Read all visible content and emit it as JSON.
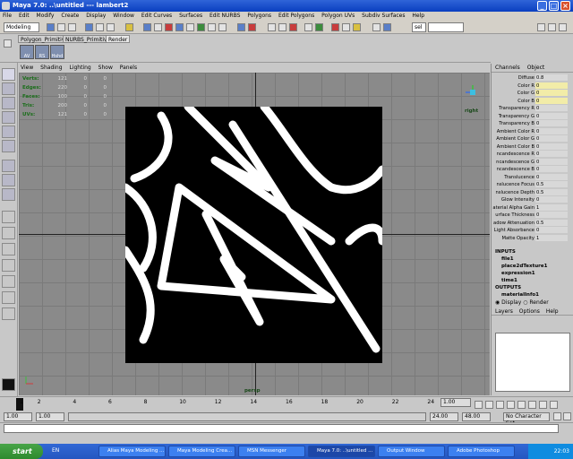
{
  "title": "Maya 7.0: ..\\untitled   ---   lambert2",
  "menus": [
    "File",
    "Edit",
    "Modify",
    "Create",
    "Display",
    "Window",
    "Edit Curves",
    "Surfaces",
    "Edit NURBS",
    "Polygons",
    "Edit Polygons",
    "Polygon UVs",
    "Subdiv Surfaces",
    "Help"
  ],
  "status": {
    "mode": "Modeling",
    "selection_field": "sel"
  },
  "shelf": {
    "tabs": [
      "Polygon_Primitives",
      "NURBS_Primitives",
      "Render"
    ],
    "buttons": [
      "AV",
      "RS",
      "Hshd"
    ]
  },
  "panel_menu": [
    "View",
    "Shading",
    "Lighting",
    "Show",
    "Panels"
  ],
  "hud": [
    {
      "label": "Verts:",
      "a": "121",
      "b": "0",
      "c": "0"
    },
    {
      "label": "Edges:",
      "a": "220",
      "b": "0",
      "c": "0"
    },
    {
      "label": "Faces:",
      "a": "100",
      "b": "0",
      "c": "0"
    },
    {
      "label": "Tris:",
      "a": "200",
      "b": "0",
      "c": "0"
    },
    {
      "label": "UVs:",
      "a": "121",
      "b": "0",
      "c": "0"
    }
  ],
  "camera_label": "persp",
  "compass": {
    "label": "right",
    "y": "y",
    "z": "z"
  },
  "channels": {
    "menu": [
      "Channels",
      "Object"
    ],
    "attrs": [
      {
        "name": "Diffuse",
        "value": "0.8",
        "highlight": false
      },
      {
        "name": "Color R",
        "value": "0",
        "highlight": true
      },
      {
        "name": "Color G",
        "value": "0",
        "highlight": true
      },
      {
        "name": "Color B",
        "value": "0",
        "highlight": true
      },
      {
        "name": "Transparency R",
        "value": "0",
        "highlight": false
      },
      {
        "name": "Transparency G",
        "value": "0",
        "highlight": false
      },
      {
        "name": "Transparency B",
        "value": "0",
        "highlight": false
      },
      {
        "name": "Ambient Color R",
        "value": "0",
        "highlight": false
      },
      {
        "name": "Ambient Color G",
        "value": "0",
        "highlight": false
      },
      {
        "name": "Ambient Color B",
        "value": "0",
        "highlight": false
      },
      {
        "name": "ncandescence R",
        "value": "0",
        "highlight": false
      },
      {
        "name": "ncandescence G",
        "value": "0",
        "highlight": false
      },
      {
        "name": "ncandescence B",
        "value": "0",
        "highlight": false
      },
      {
        "name": "Translucence",
        "value": "0",
        "highlight": false
      },
      {
        "name": "nslucence Focus",
        "value": "0.5",
        "highlight": false
      },
      {
        "name": "nslucence Depth",
        "value": "0.5",
        "highlight": false
      },
      {
        "name": "Glow Intensity",
        "value": "0",
        "highlight": false
      },
      {
        "name": "aterial Alpha Gain",
        "value": "1",
        "highlight": false
      },
      {
        "name": "urface Thickness",
        "value": "0",
        "highlight": false
      },
      {
        "name": "adow Attenuation",
        "value": "0.5",
        "highlight": false
      },
      {
        "name": "Light Absorbance",
        "value": "0",
        "highlight": false
      },
      {
        "name": "Matte Opacity",
        "value": "1",
        "highlight": false
      }
    ],
    "inputs_label": "INPUTS",
    "inputs": [
      "file1",
      "place2dTexture1",
      "expression1",
      "time1"
    ],
    "outputs_label": "OUTPUTS",
    "outputs": [
      "materialInfo1"
    ]
  },
  "layers": {
    "display": "Display",
    "render": "Render",
    "menu": [
      "Layers",
      "Options",
      "Help"
    ]
  },
  "timeline": {
    "ticks": [
      "1",
      "2",
      "4",
      "6",
      "8",
      "10",
      "12",
      "14",
      "16",
      "18",
      "20",
      "22",
      "24"
    ],
    "current": "1.00"
  },
  "range": {
    "start": "1.00",
    "start2": "1.00",
    "end": "24.00",
    "end2": "48.00",
    "character": "No Character Set"
  },
  "taskbar": {
    "start": "start",
    "lang": "EN",
    "items": [
      "Alias Maya Modeling ...",
      "Maya Modeling Crea...",
      "MSN Messenger",
      "Maya 7.0: ..\\untitled ...",
      "Output Window",
      "Adobe Photoshop"
    ],
    "clock": "22:03"
  }
}
